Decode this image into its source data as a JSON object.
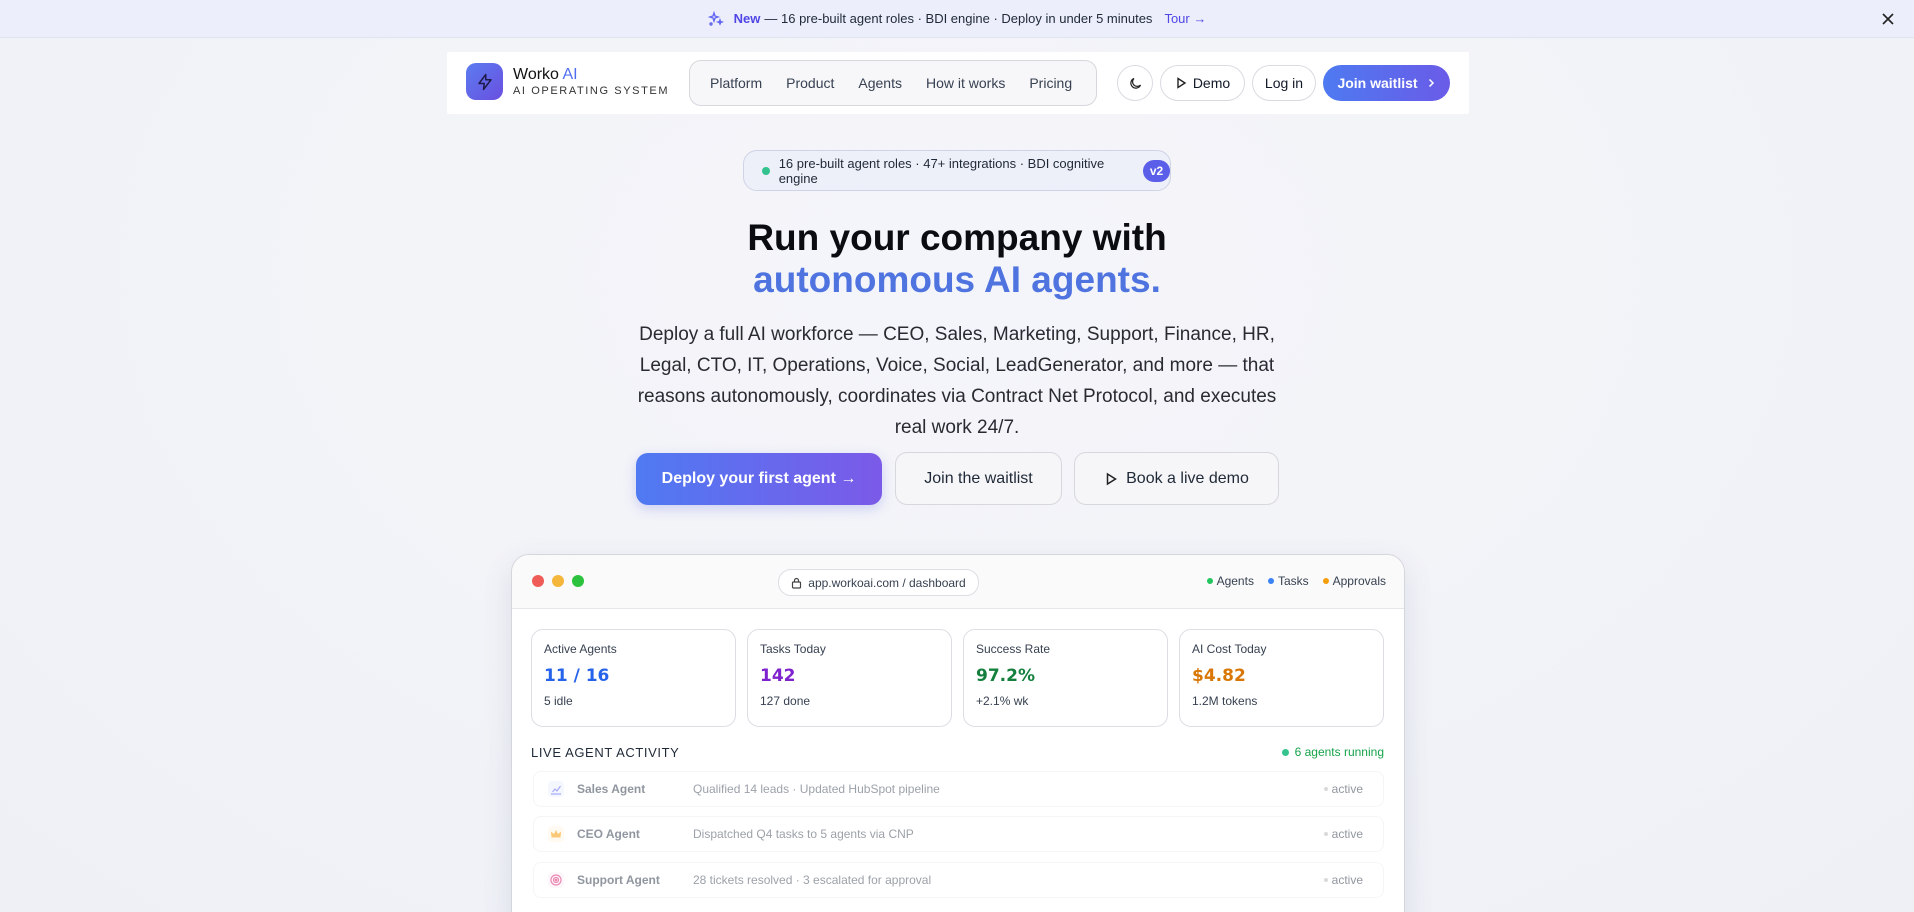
{
  "announcement": {
    "new_label": "New",
    "text": "— 16 pre-built agent roles · BDI engine · Deploy in under 5 minutes",
    "tour_label": "Tour →"
  },
  "nav": {
    "brand_name": "Worko",
    "brand_ai": "AI",
    "brand_sub": "AI OPERATING SYSTEM",
    "items": [
      "Platform",
      "Product",
      "Agents",
      "How it works",
      "Pricing"
    ],
    "demo_label": "Demo",
    "login_label": "Log in",
    "waitlist_label": "Join waitlist"
  },
  "badge": {
    "text": "16 pre-built agent roles · 47+ integrations · BDI cognitive engine",
    "version": "v2"
  },
  "hero": {
    "title_line1": "Run your company with",
    "title_line2": "autonomous AI agents.",
    "lead": "Deploy a full AI workforce — CEO, Sales, Marketing, Support, Finance, HR, Legal, CTO, IT, Operations, Voice, Social, LeadGenerator, and more — that reasons autonomously, coordinates via Contract Net Protocol, and executes real work 24/7.",
    "cta_primary": "Deploy your first agent →",
    "cta_waitlist": "Join the waitlist",
    "cta_demo": "Book a live demo"
  },
  "dashboard": {
    "url": "app.workoai.com / dashboard",
    "legend": [
      {
        "label": "Agents",
        "color": "#22c55e"
      },
      {
        "label": "Tasks",
        "color": "#3b82f6"
      },
      {
        "label": "Approvals",
        "color": "#f59e0b"
      }
    ],
    "stats": [
      {
        "label": "Active Agents",
        "value": "11 / 16",
        "sub": "5 idle",
        "color": "#2563eb"
      },
      {
        "label": "Tasks Today",
        "value": "142",
        "sub": "127 done",
        "color": "#7e22ce"
      },
      {
        "label": "Success Rate",
        "value": "97.2%",
        "sub": "+2.1% wk",
        "color": "#15803d"
      },
      {
        "label": "AI Cost Today",
        "value": "$4.82",
        "sub": "1.2M tokens",
        "color": "#d97706"
      }
    ],
    "activity_title": "LIVE AGENT ACTIVITY",
    "running_label": "6 agents running",
    "activity": [
      {
        "name": "Sales Agent",
        "desc": "Qualified 14 leads · Updated HubSpot pipeline",
        "status": "active",
        "icon": "chart-icon"
      },
      {
        "name": "CEO Agent",
        "desc": "Dispatched Q4 tasks to 5 agents via CNP",
        "status": "active",
        "icon": "crown-icon"
      },
      {
        "name": "Support Agent",
        "desc": "28 tickets resolved · 3 escalated for approval",
        "status": "active",
        "icon": "target-icon"
      }
    ]
  }
}
